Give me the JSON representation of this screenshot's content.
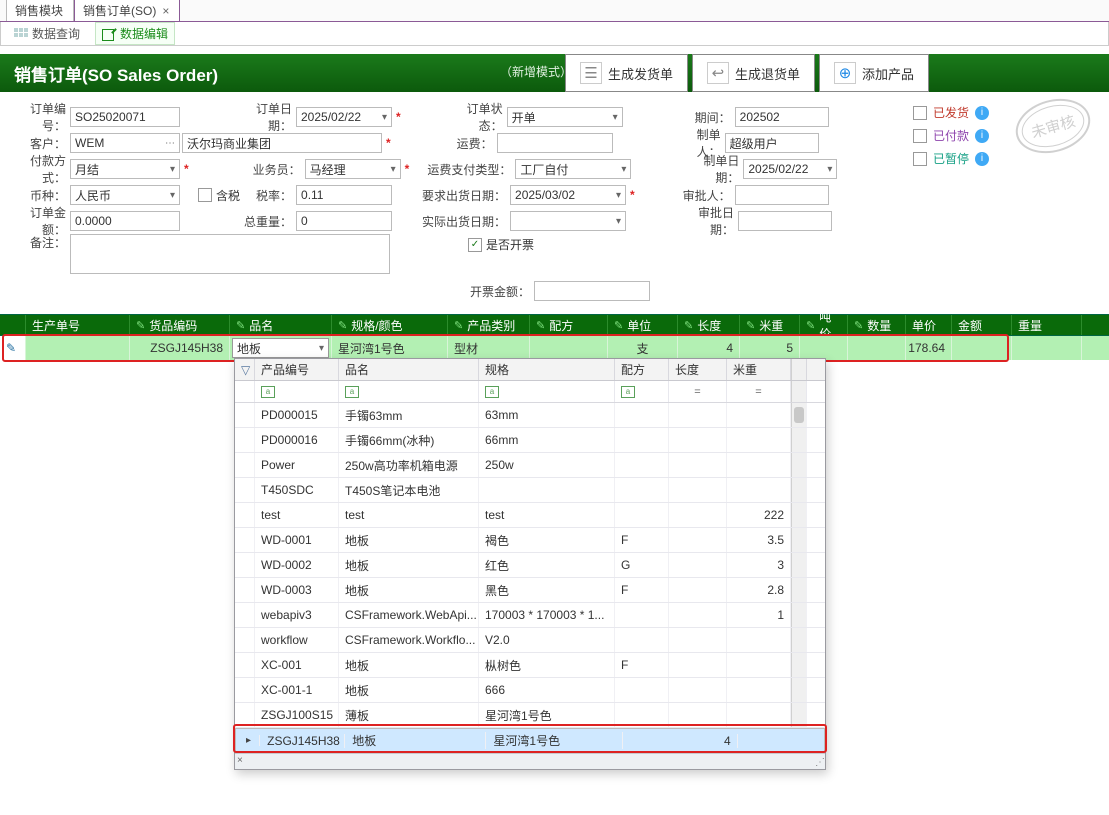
{
  "tabs": {
    "module": "销售模块",
    "so": "销售订单(SO)"
  },
  "subtabs": {
    "query": "数据查询",
    "edit": "数据编辑"
  },
  "ribbon": {
    "title": "销售订单(SO Sales Order)",
    "mode": "（新增模式）",
    "btn_delivery": "生成发货单",
    "btn_return": "生成退货单",
    "btn_add": "添加产品"
  },
  "form": {
    "order_no_lbl": "订单编号：",
    "order_no": "SO25020071",
    "order_date_lbl": "订单日期：",
    "order_date": "2025/02/22",
    "customer_lbl": "客户：",
    "customer_code": "WEM",
    "customer_name": "沃尔玛商业集团",
    "pay_lbl": "付款方式：",
    "pay": "月结",
    "sales_lbl": "业务员：",
    "sales": "马经理",
    "currency_lbl": "币种：",
    "currency": "人民币",
    "tax_incl_lbl": "含税",
    "rate_lbl": "税率：",
    "rate": "0.11",
    "amount_lbl": "订单金额：",
    "amount": "0.0000",
    "weight_lbl": "总重量：",
    "weight": "0",
    "remark_lbl": "备注：",
    "status_lbl": "订单状态：",
    "status": "开单",
    "freight_lbl": "运费：",
    "freight_pay_lbl": "运费支付类型：",
    "freight_pay": "工厂自付",
    "req_ship_lbl": "要求出货日期：",
    "req_ship": "2025/03/02",
    "actual_ship_lbl": "实际出货日期：",
    "invoice_chk_lbl": "是否开票",
    "invoice_amt_lbl": "开票金额：",
    "period_lbl": "期间：",
    "period": "202502",
    "creator_lbl": "制单人：",
    "creator": "超级用户",
    "create_date_lbl": "制单日期：",
    "create_date": "2025/02/22",
    "approver_lbl": "审批人：",
    "approve_date_lbl": "审批日期："
  },
  "checks": {
    "shipped": "已发货",
    "paid": "已付款",
    "paused": "已暂停"
  },
  "stamp": "未审核",
  "grid": {
    "headers": [
      "生产单号",
      "货品编码",
      "品名",
      "规格/颜色",
      "产品类别",
      "配方",
      "单位",
      "长度",
      "米重",
      "吨价",
      "数量",
      "单价",
      "金额",
      "重量"
    ],
    "row": {
      "code": "ZSGJ145H38",
      "name": "地板",
      "spec": "星河湾1号色",
      "category": "型材",
      "unit": "支",
      "length": "4",
      "mweight": "5",
      "price": "178.64"
    }
  },
  "dropdown": {
    "headers": [
      "产品编号",
      "品名",
      "规格",
      "配方",
      "长度",
      "米重"
    ],
    "rows": [
      {
        "code": "PD000015",
        "name": "手镯63mm",
        "spec": "63mm",
        "recipe": "",
        "len": "",
        "mw": ""
      },
      {
        "code": "PD000016",
        "name": "手镯66mm(冰种)",
        "spec": "66mm",
        "recipe": "",
        "len": "",
        "mw": ""
      },
      {
        "code": "Power",
        "name": "250w高功率机箱电源",
        "spec": "250w",
        "recipe": "",
        "len": "",
        "mw": ""
      },
      {
        "code": "T450SDC",
        "name": "T450S笔记本电池",
        "spec": "",
        "recipe": "",
        "len": "",
        "mw": ""
      },
      {
        "code": "test",
        "name": "test",
        "spec": "test",
        "recipe": "",
        "len": "",
        "mw": "222"
      },
      {
        "code": "WD-0001",
        "name": "地板",
        "spec": "褐色",
        "recipe": "F",
        "len": "",
        "mw": "3.5"
      },
      {
        "code": "WD-0002",
        "name": "地板",
        "spec": "红色",
        "recipe": "G",
        "len": "",
        "mw": "3"
      },
      {
        "code": "WD-0003",
        "name": "地板",
        "spec": "黑色",
        "recipe": "F",
        "len": "",
        "mw": "2.8"
      },
      {
        "code": "webapiv3",
        "name": "CSFramework.WebApi...",
        "spec": "170003 * 170003 * 1...",
        "recipe": "",
        "len": "",
        "mw": "1"
      },
      {
        "code": "workflow",
        "name": "CSFramework.Workflo...",
        "spec": "V2.0",
        "recipe": "",
        "len": "",
        "mw": ""
      },
      {
        "code": "XC-001",
        "name": "地板",
        "spec": "枞树色",
        "recipe": "F",
        "len": "",
        "mw": ""
      },
      {
        "code": "XC-001-1",
        "name": "地板",
        "spec": "666",
        "recipe": "",
        "len": "",
        "mw": ""
      },
      {
        "code": "ZSGJ100S15",
        "name": "薄板",
        "spec": "星河湾1号色",
        "recipe": "",
        "len": "",
        "mw": ""
      },
      {
        "code": "ZSGJ145H38",
        "name": "地板",
        "spec": "星河湾1号色",
        "recipe": "",
        "len": "4",
        "mw": ""
      }
    ]
  }
}
